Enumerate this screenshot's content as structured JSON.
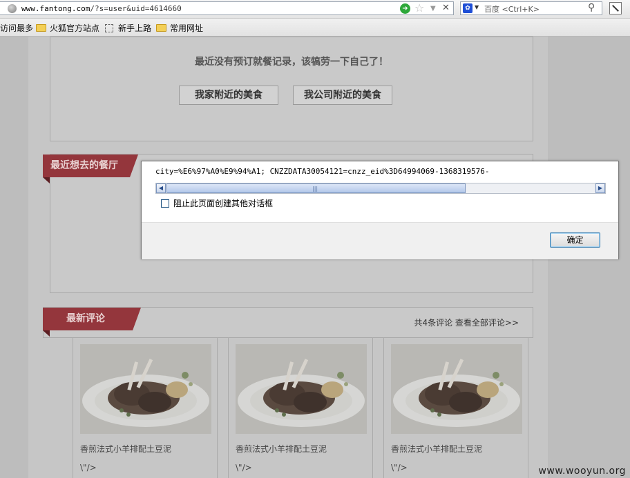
{
  "browser": {
    "url_host": "www.fantong.com",
    "url_path": "/?s=user&uid=4614660",
    "search_engine": "百度",
    "search_shortcut": "<Ctrl+K>",
    "bookmarks": [
      {
        "label": "访问最多",
        "icon": "none"
      },
      {
        "label": "火狐官方站点",
        "icon": "folder-icon"
      },
      {
        "label": "新手上路",
        "icon": "blank-page-icon"
      },
      {
        "label": "常用网址",
        "icon": "folder-icon"
      }
    ]
  },
  "page": {
    "no_record_text": "最近没有预订就餐记录，该犒劳一下自己了！",
    "home_nearby_button": "我家附近的美食",
    "office_nearby_button": "我公司附近的美食",
    "recent_want_title": "最近想去的餐厅",
    "latest_comments_title": "最新评论",
    "comment_count_text": "共4条评论 查看全部评论>>",
    "food_cards": [
      {
        "name": "香煎法式小羊排配土豆泥",
        "extra": "\\\"/>"
      },
      {
        "name": "香煎法式小羊排配土豆泥",
        "extra": "\\\"/>"
      },
      {
        "name": "香煎法式小羊排配土豆泥",
        "extra": "\\\"/>"
      }
    ],
    "watermark": "www.wooyun.org"
  },
  "dialog": {
    "message": "city=%E6%97%A0%E9%94%A1; CNZZDATA30054121=cnzz_eid%3D64994069-1368319576-",
    "checkbox_label": "阻止此页面创建其他对话框",
    "ok_label": "确定"
  },
  "colors": {
    "ribbon": "#94363c",
    "dialog_border": "#7c7c7c",
    "ok_focus": "#3c7fb1"
  }
}
